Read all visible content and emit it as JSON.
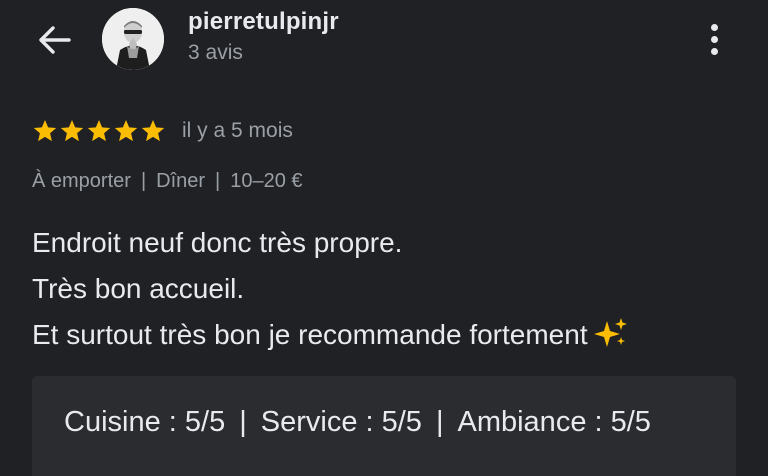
{
  "header": {
    "back_icon": "arrow-left-icon",
    "username": "pierretulpinjr",
    "review_count": "3 avis",
    "menu_icon": "more-vertical-icon"
  },
  "review": {
    "stars": 5,
    "star_color": "#fbbc04",
    "time_ago": "il y a 5 mois",
    "meta": {
      "service_type": "À emporter",
      "meal_type": "Dîner",
      "price_range": "10–20 €",
      "separator": "|"
    },
    "text_lines": [
      "Endroit neuf donc très propre.",
      "Très bon accueil.",
      "Et surtout très bon je recommande fortement"
    ],
    "sparkle_icon": "sparkles-icon",
    "sub_ratings": {
      "cuisine": "Cuisine : 5/5",
      "service": "Service : 5/5",
      "ambiance": "Ambiance : 5/5",
      "separator": "|"
    }
  },
  "colors": {
    "background": "#202124",
    "text_primary": "#e8eaed",
    "text_secondary": "#9aa0a6",
    "star": "#fbbc04",
    "panel": "#2a2c30"
  }
}
